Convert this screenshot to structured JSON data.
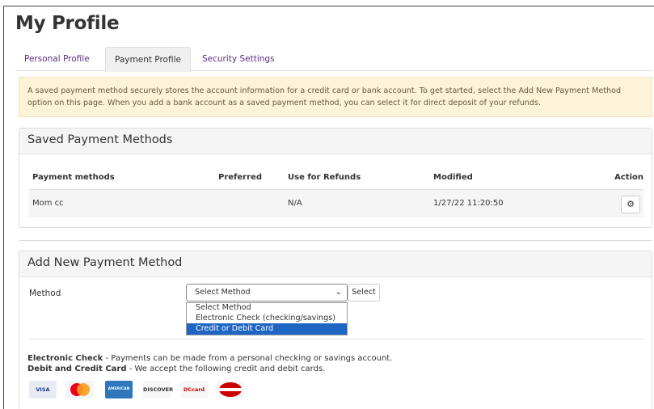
{
  "page": {
    "title": "My Profile"
  },
  "tabs": [
    {
      "label": "Personal Profile",
      "active": false
    },
    {
      "label": "Payment Profile",
      "active": true
    },
    {
      "label": "Security Settings",
      "active": false
    }
  ],
  "alert": {
    "text": "A saved payment method securely stores the account information for a credit card or bank account. To get started, select the Add New Payment Method option on this page. When you add a bank account as a saved payment method, you can select it for direct deposit of your refunds."
  },
  "saved_methods": {
    "heading": "Saved Payment Methods",
    "columns": [
      "Payment methods",
      "Preferred",
      "Use for Refunds",
      "Modified",
      "Action"
    ],
    "rows": [
      {
        "name": "Mom cc",
        "preferred": "",
        "use_for_refunds": "N/A",
        "modified": "1/27/22 11:20:50"
      }
    ]
  },
  "add_method": {
    "heading": "Add New Payment Method",
    "method_label": "Method",
    "selected_value": "Select Method",
    "select_button": "Select",
    "options": [
      "Select Method",
      "Electronic Check (checking/savings)",
      "Credit or Debit Card"
    ],
    "highlighted_option_index": 2,
    "electronic_check_title": "Electronic Check",
    "electronic_check_text": " - Payments can be made from a personal checking or savings account.",
    "debit_credit_title": "Debit and Credit Card",
    "debit_credit_text": " - We accept the following credit and debit cards."
  },
  "cards": [
    {
      "label": "VISA",
      "bg": "#e8ebf2",
      "fg": "#1a3a8c"
    },
    {
      "label": "",
      "bg": "#f5f5f5",
      "fg": "#eb001b"
    },
    {
      "label": "AMERICAN EXPRESS",
      "bg": "#2e77bb",
      "fg": "#ffffff"
    },
    {
      "label": "DISCOVER",
      "bg": "#f7f7f7",
      "fg": "#333333"
    },
    {
      "label": "DCcard",
      "bg": "#f7f7f7",
      "fg": "#cc0000"
    },
    {
      "label": "DinersClub",
      "bg": "#f7f7f7",
      "fg": "#cc0000"
    }
  ],
  "colors": {
    "accent": "#5a2d82",
    "alert_bg": "#fcf3d9",
    "highlight": "#1f66c4"
  },
  "icons": {
    "action": "gear-icon",
    "select_chevron": "chevron-down-icon"
  }
}
